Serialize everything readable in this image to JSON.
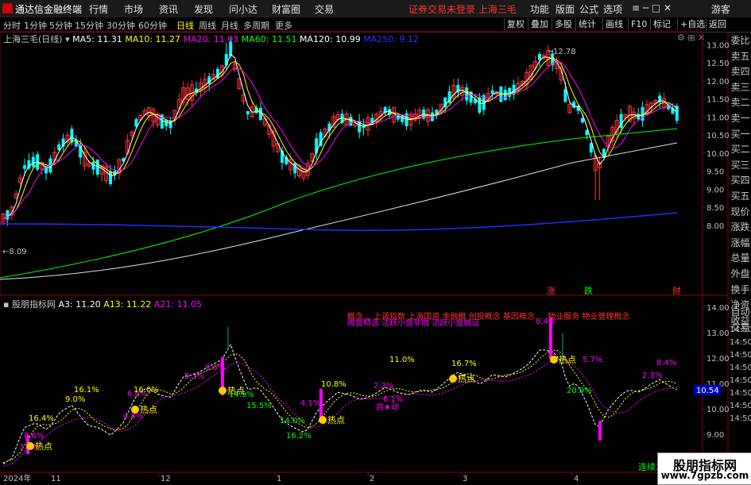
{
  "menu": {
    "brand": "通达信金融终端",
    "items": [
      "行情",
      "市场",
      "资讯",
      "发现",
      "问小达",
      "财富圈",
      "交易"
    ],
    "warning": "证券交易未登录 上海三毛",
    "right": [
      "功能",
      "版面",
      "公式",
      "选项"
    ],
    "guest": "游客"
  },
  "periods": [
    "分时",
    "1分钟",
    "5分钟",
    "15分钟",
    "30分钟",
    "60分钟",
    "日线",
    "周线",
    "月线",
    "多周期",
    "更多"
  ],
  "active_period": "日线",
  "toolbar": [
    "复权",
    "叠加",
    "多股",
    "统计",
    "画线",
    "F10",
    "标记",
    "+自选",
    "返回"
  ],
  "main_legend": {
    "title": "上海三毛(日线)",
    "ma": [
      {
        "label": "MA5: 11.31",
        "color": "#ffffff"
      },
      {
        "label": "MA10: 11.27",
        "color": "#ffff00"
      },
      {
        "label": "MA20: 11.03",
        "color": "#ff00ff"
      },
      {
        "label": "MA60: 11.51",
        "color": "#00ff00"
      },
      {
        "label": "MA120: 10.99",
        "color": "#ffffff"
      },
      {
        "label": "MA250: 9.12",
        "color": "#3030ff"
      }
    ]
  },
  "sub_legend": {
    "title": "股朋指标网",
    "items": [
      {
        "label": "A3: 11.20",
        "color": "#ffffff"
      },
      {
        "label": "A13: 11.22",
        "color": "#ffff00"
      },
      {
        "label": "A21: 11.05",
        "color": "#ff00ff"
      }
    ]
  },
  "right_panel": {
    "labels": [
      "委比",
      "卖五",
      "卖四",
      "卖三",
      "卖二",
      "卖一",
      "买一",
      "买二",
      "买三",
      "买四",
      "买五",
      "现价",
      "涨跌",
      "涨幅",
      "总量",
      "外盘",
      "换手",
      "净资",
      "收益"
    ],
    "sub": [
      "自动",
      "交易"
    ]
  },
  "main_axis": [
    "13.00",
    "12.50",
    "12.00",
    "11.50",
    "11.00",
    "10.50",
    "10.00",
    "9.50",
    "9.00",
    "8.50",
    "8.00"
  ],
  "sub_axis": [
    "14.00",
    "13.00",
    "12.00",
    "11.00",
    "10.00",
    "9.00"
  ],
  "sub_axis_extra": [
    "14:50",
    "14:50",
    "14:50",
    "14:50",
    "14:50",
    "14:50",
    "14:50",
    "14:50"
  ],
  "current_value": "10.54",
  "high_label": "12.78",
  "low_label": "8.09",
  "markers": {
    "zhang": "涨",
    "die": "跌",
    "cai": "财"
  },
  "date_axis": [
    "2024年",
    "11",
    "12",
    "1",
    "2",
    "3",
    "4"
  ],
  "concepts_top": "概念… 上调指数 上海国资 金融概 创投概念 基因概念 … 物业服务 物业管理概念",
  "concepts_bottom": "微盘精选 活跃小盘非融 活跃小盘融证",
  "pct_labels": [
    "3.3%",
    "8.6%",
    "16.4%",
    "9.0%",
    "16.1%",
    "6.8%",
    "16.0%",
    "4.8%",
    "5.3%",
    "8.6%",
    "14.9%",
    "15.5%",
    "14.0%",
    "16.2%",
    "4.1%",
    "10.8%",
    "6.1%",
    "2.3%",
    "11.0%",
    "16.7%",
    "8.4%",
    "5.7%",
    "20.9%",
    "2.3%",
    "8.4%"
  ],
  "hot_label": "热点",
  "qidong_label": "启★动",
  "lianban_label": "连续3",
  "watermark": {
    "t1": "股朋指标网",
    "t2": "www.7gpzb.com"
  },
  "colors": {
    "up": "#ff3232",
    "down": "#00ffff",
    "ma5": "#ffffff",
    "ma10": "#ffff00",
    "ma20": "#ff00ff",
    "ma60": "#00ff00",
    "ma120": "#e0e0e0",
    "ma250": "#2030ff"
  }
}
